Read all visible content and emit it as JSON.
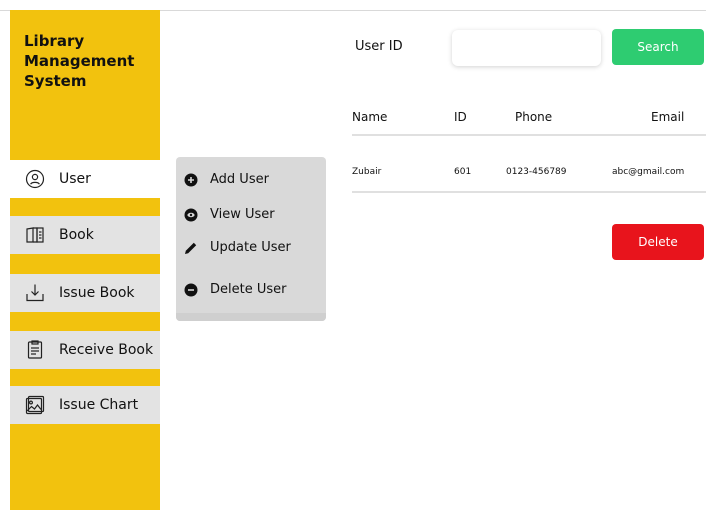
{
  "app": {
    "title": "Library Management System"
  },
  "sidebar": {
    "items": [
      {
        "label": "User",
        "icon": "user-icon",
        "active": true
      },
      {
        "label": "Book",
        "icon": "book-icon",
        "active": false
      },
      {
        "label": "Issue Book",
        "icon": "download-icon",
        "active": false
      },
      {
        "label": "Receive Book",
        "icon": "clipboard-icon",
        "active": false
      },
      {
        "label": "Issue Chart",
        "icon": "image-icon",
        "active": false
      }
    ]
  },
  "submenu": {
    "items": [
      {
        "label": "Add User",
        "icon": "plus-circle-icon"
      },
      {
        "label": "View User",
        "icon": "eye-icon"
      },
      {
        "label": "Update User",
        "icon": "pencil-icon"
      },
      {
        "label": "Delete User",
        "icon": "minus-circle-icon"
      }
    ]
  },
  "search": {
    "label": "User ID",
    "value": "",
    "button_label": "Search"
  },
  "table": {
    "columns": [
      "Name",
      "ID",
      "Phone",
      "Email"
    ],
    "rows": [
      [
        "Zubair",
        "601",
        "0123-456789",
        "abc@gmail.com"
      ]
    ]
  },
  "actions": {
    "delete_label": "Delete"
  },
  "colors": {
    "sidebar": "#f2c20e",
    "search_button": "#2ecc71",
    "delete_button": "#e8141c",
    "submenu": "#d9d9d9"
  }
}
